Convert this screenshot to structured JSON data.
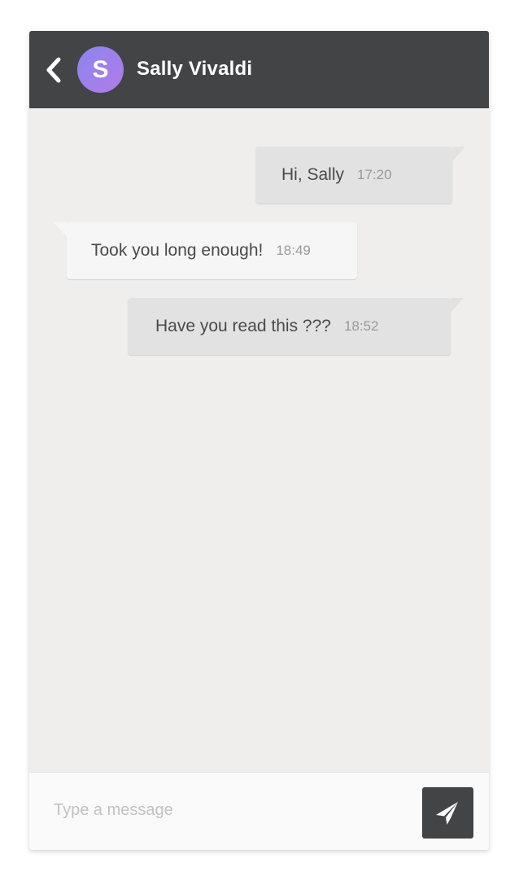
{
  "header": {
    "contact_name": "Sally Vivaldi",
    "avatar_initial": "S",
    "back_icon": "chevron-left-icon"
  },
  "messages": [
    {
      "direction": "outgoing",
      "text": "Hi, Sally",
      "time": "17:20"
    },
    {
      "direction": "incoming",
      "text": "Took you long enough!",
      "time": "18:49"
    },
    {
      "direction": "outgoing",
      "text": "Have you read this ???",
      "time": "18:52"
    }
  ],
  "composer": {
    "placeholder": "Type a message",
    "value": "",
    "send_icon": "paper-plane-icon"
  },
  "colors": {
    "header_background": "#424446",
    "avatar_gradient_start": "#8b85ee",
    "avatar_gradient_end": "#b27be8",
    "chat_background": "#efeeed",
    "outgoing_bubble": "#e2e2e2",
    "incoming_bubble": "#f6f6f6",
    "send_button": "#424446"
  }
}
